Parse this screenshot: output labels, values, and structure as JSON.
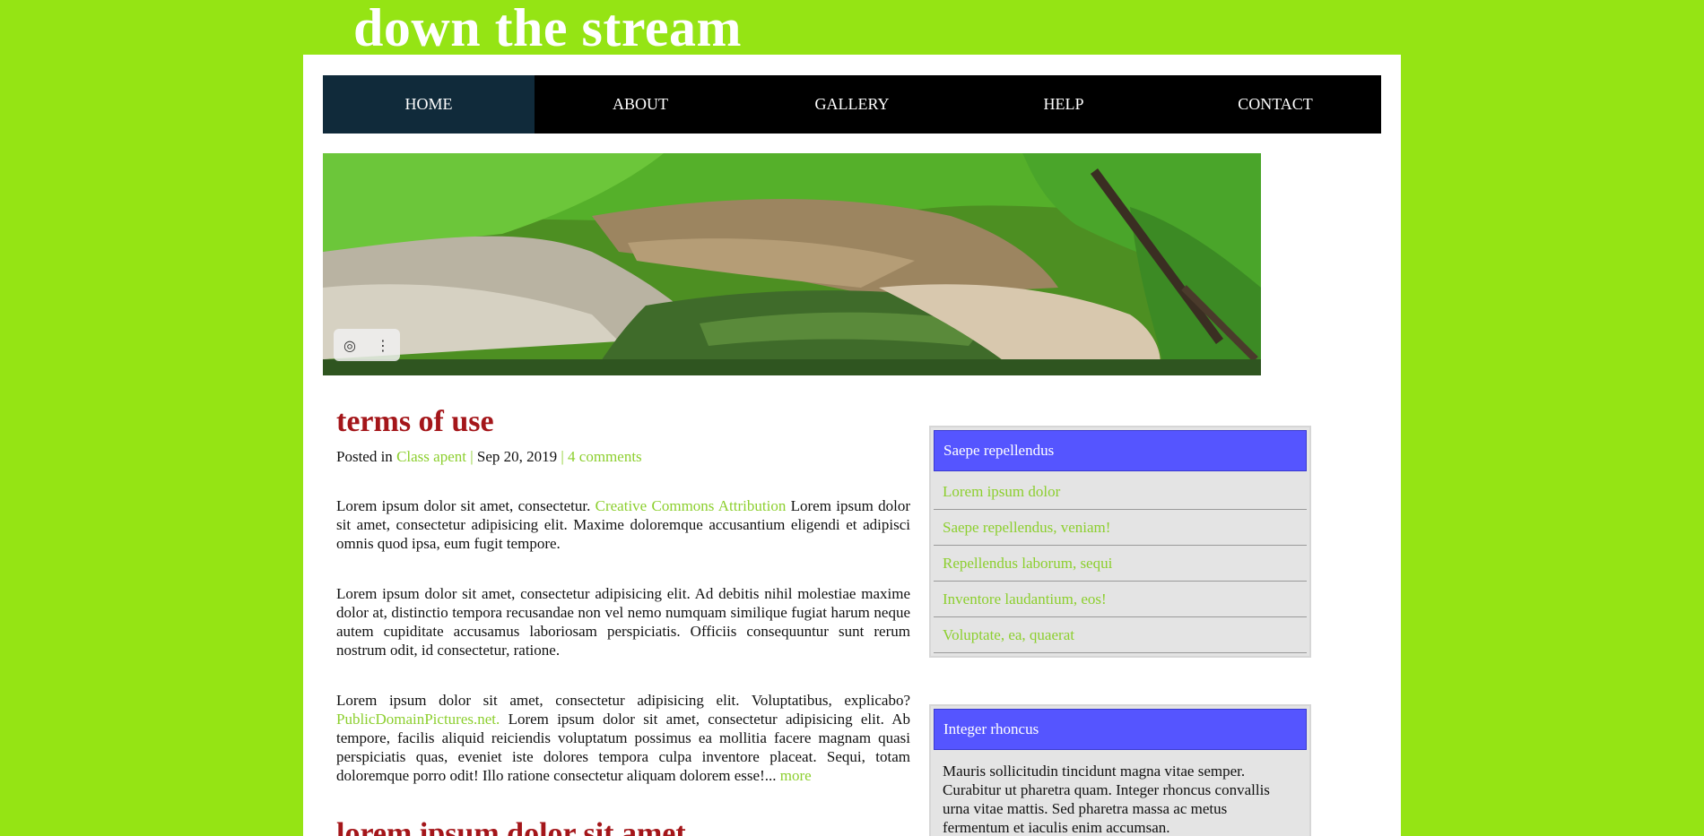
{
  "site": {
    "title": "down the stream"
  },
  "nav": {
    "items": [
      {
        "label": "HOME",
        "active": true
      },
      {
        "label": "ABOUT"
      },
      {
        "label": "GALLERY"
      },
      {
        "label": "HELP"
      },
      {
        "label": "CONTACT"
      }
    ]
  },
  "hero": {
    "icons": [
      "lens-icon",
      "more-vertical-icon"
    ],
    "lens_glyph": "◎",
    "more_glyph": "⋮"
  },
  "post": {
    "title": "terms of use",
    "meta_prefix": "Posted in ",
    "category": "Class apent",
    "sep1": " | ",
    "date": "Sep 20, 2019",
    "sep2": " | ",
    "comments": "4 comments",
    "p1_a": "Lorem ipsum dolor sit amet, consectetur. ",
    "p1_link": "Creative Commons Attribution",
    "p1_b": " Lorem ipsum dolor sit amet, consectetur adipisicing elit. Maxime doloremque accusantium eligendi et adipisci omnis quod ipsa, eum fugit tempore.",
    "p2": "Lorem ipsum dolor sit amet, consectetur adipisicing elit. Ad debitis nihil molestiae maxime dolor at, distinctio tempora recusandae non vel nemo numquam similique fugiat harum neque autem cupiditate accusamus laboriosam perspiciatis. Officiis consequuntur sunt rerum nostrum odit, id consectetur, ratione.",
    "p3_a": "Lorem ipsum dolor sit amet, consectetur adipisicing elit. Voluptatibus, explicabo? ",
    "p3_link": "PublicDomainPictures.net.",
    "p3_b": " Lorem ipsum dolor sit amet, consectetur adipisicing elit. Ab tempore, facilis aliquid reiciendis voluptatum possimus ea mollitia facere magnam quasi perspiciatis quas, eveniet iste dolores tempora culpa inventore placeat. Sequi, totam doloremque porro odit! Illo ratione consectetur aliquam dolorem esse!... ",
    "more": "more",
    "next_title": "lorem ipsum dolor sit amet"
  },
  "sidebar": {
    "widget1": {
      "title": "Saepe repellendus",
      "links": [
        "Lorem ipsum dolor",
        "Saepe repellendus, veniam!",
        "Repellendus laborum, sequi",
        "Inventore laudantium, eos!",
        "Voluptate, ea, quaerat"
      ]
    },
    "widget2": {
      "title": "Integer rhoncus",
      "text": "Mauris sollicitudin tincidunt magna vitae semper. Curabitur ut pharetra quam. Integer rhoncus convallis urna vitae mattis. Sed pharetra massa ac metus fermentum et iaculis enim accumsan."
    }
  },
  "colors": {
    "background": "#95e414",
    "nav_bg": "#000000",
    "nav_active": "#102a3a",
    "link": "#8ccf2e",
    "post_title": "#a4161a",
    "widget_head": "#5555ff"
  }
}
